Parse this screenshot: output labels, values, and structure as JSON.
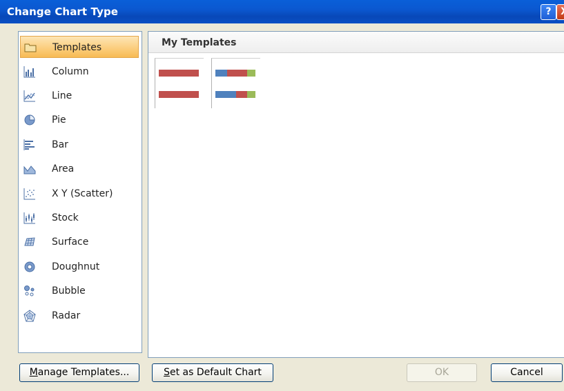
{
  "window": {
    "title": "Change Chart Type",
    "help_glyph": "?",
    "close_glyph": "X"
  },
  "chart_types": [
    {
      "label": "Templates",
      "icon": "folder-icon",
      "selected": true
    },
    {
      "label": "Column",
      "icon": "column-chart-icon"
    },
    {
      "label": "Line",
      "icon": "line-chart-icon"
    },
    {
      "label": "Pie",
      "icon": "pie-chart-icon"
    },
    {
      "label": "Bar",
      "icon": "bar-chart-icon"
    },
    {
      "label": "Area",
      "icon": "area-chart-icon"
    },
    {
      "label": "X Y (Scatter)",
      "icon": "scatter-chart-icon"
    },
    {
      "label": "Stock",
      "icon": "stock-chart-icon"
    },
    {
      "label": "Surface",
      "icon": "surface-chart-icon"
    },
    {
      "label": "Doughnut",
      "icon": "doughnut-chart-icon"
    },
    {
      "label": "Bubble",
      "icon": "bubble-chart-icon"
    },
    {
      "label": "Radar",
      "icon": "radar-chart-icon"
    }
  ],
  "main": {
    "section_title": "My Templates"
  },
  "template_colors": {
    "red": "#c0504d",
    "blue": "#4f81bd",
    "green": "#9bbb59"
  },
  "buttons": {
    "manage_templates": {
      "label": "Manage Templates...",
      "access_key": "M"
    },
    "set_default": {
      "label": "Set as Default Chart",
      "access_key": "S"
    },
    "ok": {
      "label": "OK"
    },
    "cancel": {
      "label": "Cancel"
    }
  }
}
